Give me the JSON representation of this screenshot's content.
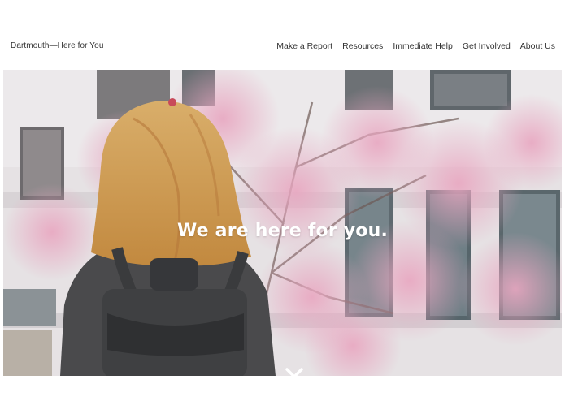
{
  "header": {
    "site_title": "Dartmouth—Here for You",
    "nav": [
      {
        "label": "Make a Report"
      },
      {
        "label": "Resources"
      },
      {
        "label": "Immediate Help"
      },
      {
        "label": "Get Involved"
      },
      {
        "label": "About Us"
      }
    ]
  },
  "hero": {
    "heading": "We are here for you.",
    "scroll_icon": "chevron-down-icon"
  },
  "colors": {
    "background": "#ffffff",
    "heading": "#ffffff",
    "nav_text": "#333333"
  }
}
